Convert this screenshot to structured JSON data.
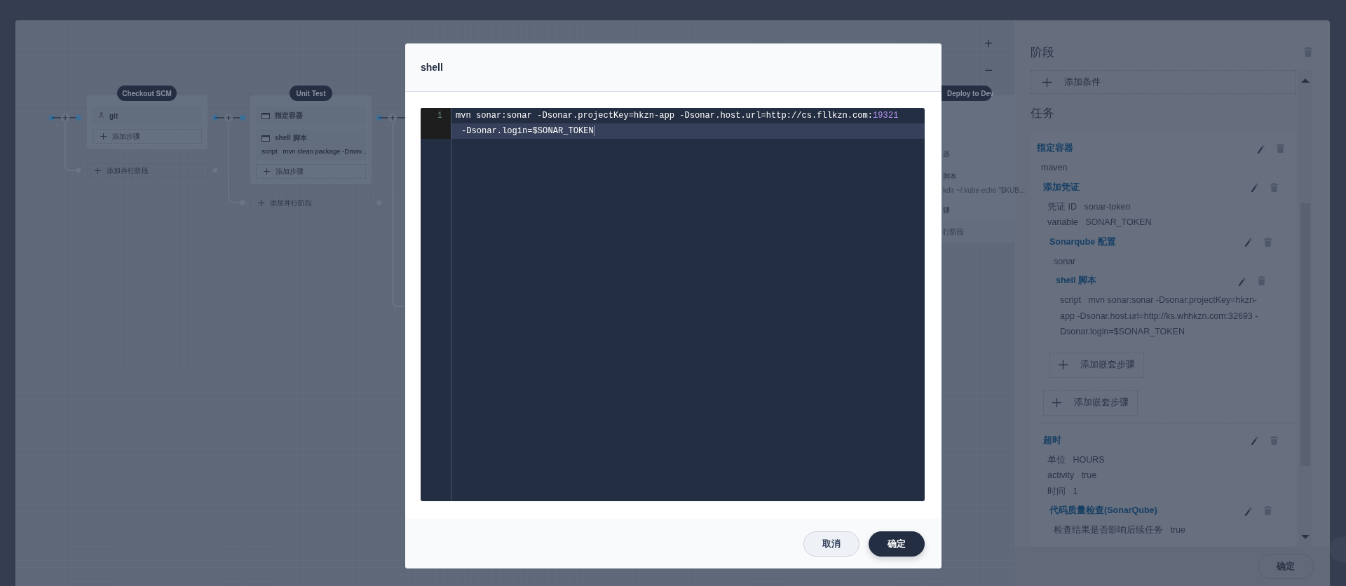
{
  "pipeline": {
    "zoom_in": "+",
    "zoom_out": "−",
    "stages": [
      {
        "name": "Checkout SCM",
        "steps": [
          {
            "kind": "git",
            "title": "git"
          }
        ],
        "add_step": "添加步骤",
        "add_parallel": "添加并行阶段"
      },
      {
        "name": "Unit Test",
        "steps": [
          {
            "kind": "container",
            "title": "指定容器"
          },
          {
            "kind": "shell",
            "title": "shell 脚本",
            "script_label": "script",
            "script": "mvn clean package -Dmav..."
          }
        ],
        "add_step": "添加步骤",
        "add_parallel": "添加并行阶段"
      }
    ],
    "partial_stage": {
      "name": "Deploy to Dev",
      "fragments": [
        "器",
        "脚本",
        "kdir ~/.kube echo \"$KUB...",
        "骤",
        "行阶段"
      ]
    }
  },
  "modal": {
    "title": "shell",
    "editor": {
      "line_number": "1",
      "tokens": [
        {
          "kind": "plain",
          "text": "mvn sonar:sonar -Dsonar.projectKey=hkzn-app -Dsonar.host.url=http://cs.fllkzn.com:"
        },
        {
          "kind": "number",
          "text": "19321"
        },
        {
          "kind": "plain",
          "text": " -Dsonar.login=$SONAR_TOKEN"
        }
      ]
    },
    "buttons": [
      {
        "kind": "secondary",
        "label": "取消"
      },
      {
        "kind": "primary",
        "label": "确定"
      }
    ]
  },
  "side_panel": {
    "stage_heading": "阶段",
    "add_condition": "添加条件",
    "tasks_heading": "任务",
    "tasks": [
      {
        "title": "指定容器",
        "fields": [
          {
            "value": "maven"
          }
        ],
        "children": [
          {
            "title": "添加凭证",
            "fields": [
              {
                "label": "凭证 ID",
                "value": "sonar-token"
              },
              {
                "label": "variable",
                "value": "SONAR_TOKEN"
              }
            ],
            "children": [
              {
                "title": "Sonarqube 配置",
                "fields": [
                  {
                    "value": "sonar"
                  }
                ],
                "children": [
                  {
                    "title": "shell 脚本",
                    "fields": [
                      {
                        "label": "script",
                        "value": "mvn sonar:sonar -Dsonar.projectKey=hkzn-app -Dsonar.host.url=http://ks.whhkzn.com:32693 -Dsonar.login=$SONAR_TOKEN"
                      }
                    ]
                  }
                ],
                "add_nested": "添加嵌套步骤"
              }
            ],
            "add_nested": "添加嵌套步骤"
          },
          {
            "title": "超时",
            "fields": [
              {
                "label": "单位",
                "value": "HOURS"
              },
              {
                "label": "activity",
                "value": "true"
              },
              {
                "label": "时间",
                "value": "1"
              }
            ],
            "children": [
              {
                "title": "代码质量检查(SonarQube)",
                "fields": [
                  {
                    "label": "检查结果是否影响后续任务",
                    "value": "true"
                  }
                ]
              }
            ]
          }
        ]
      }
    ],
    "confirm": "确定"
  }
}
